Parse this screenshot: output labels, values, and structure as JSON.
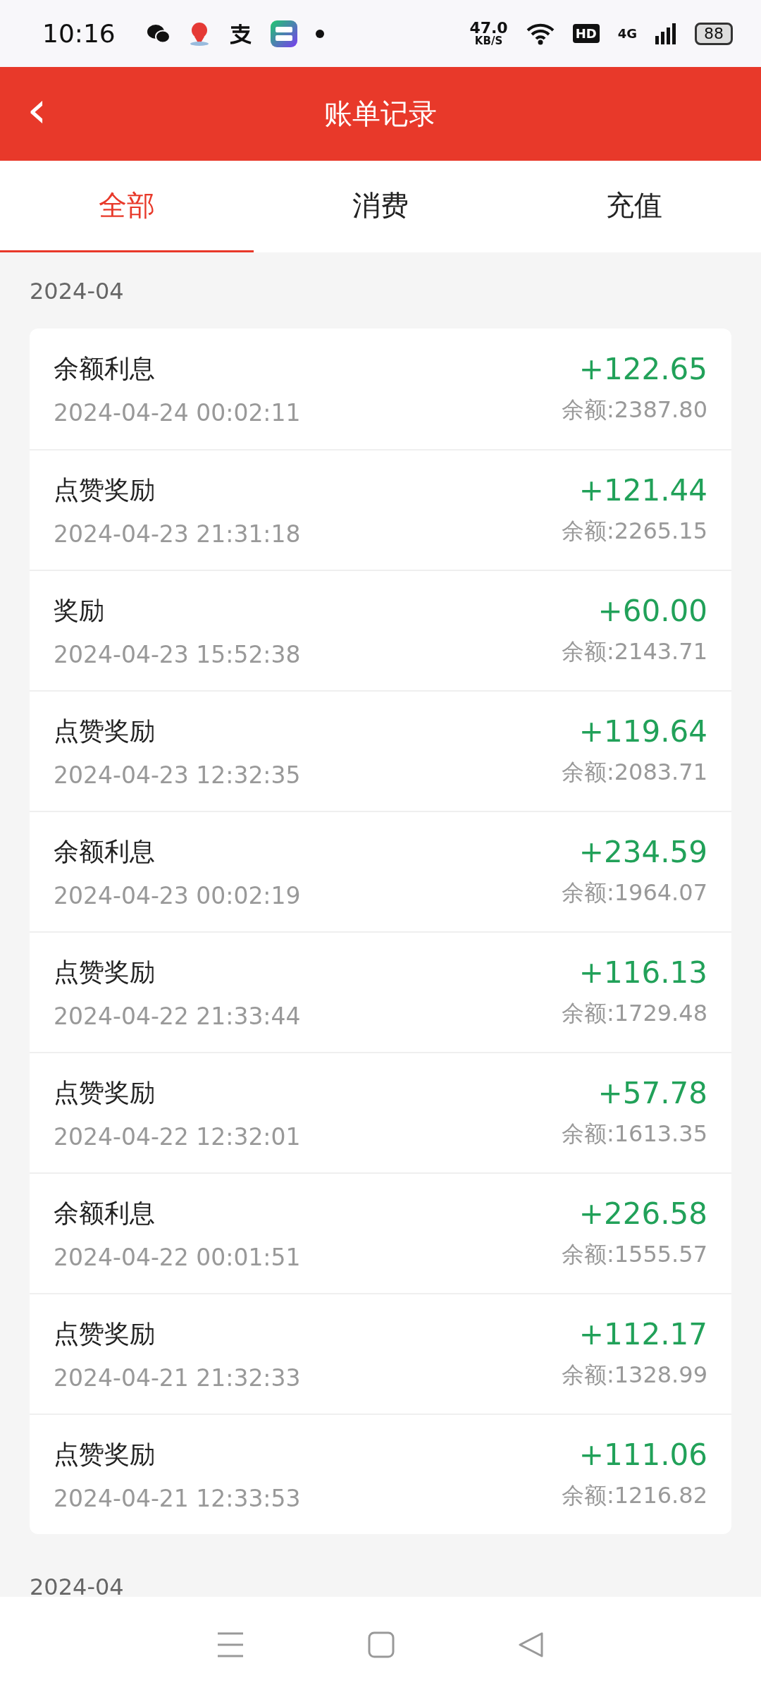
{
  "status_bar": {
    "time": "10:16",
    "net_speed": "47.0",
    "net_unit": "KB/S",
    "hd": "HD",
    "network": "4G",
    "battery": "88"
  },
  "header": {
    "back": "‹",
    "title": "账单记录"
  },
  "tabs": [
    {
      "label": "全部",
      "selected": true
    },
    {
      "label": "消费",
      "selected": false
    },
    {
      "label": "充值",
      "selected": false
    }
  ],
  "sections": [
    {
      "month": "2024-04",
      "records": [
        {
          "title": "余额利息",
          "time": "2024-04-24 00:02:11",
          "amount": "+122.65",
          "balance": "余额:2387.80"
        },
        {
          "title": "点赞奖励",
          "time": "2024-04-23 21:31:18",
          "amount": "+121.44",
          "balance": "余额:2265.15"
        },
        {
          "title": "奖励",
          "time": "2024-04-23 15:52:38",
          "amount": "+60.00",
          "balance": "余额:2143.71"
        },
        {
          "title": "点赞奖励",
          "time": "2024-04-23 12:32:35",
          "amount": "+119.64",
          "balance": "余额:2083.71"
        },
        {
          "title": "余额利息",
          "time": "2024-04-23 00:02:19",
          "amount": "+234.59",
          "balance": "余额:1964.07"
        },
        {
          "title": "点赞奖励",
          "time": "2024-04-22 21:33:44",
          "amount": "+116.13",
          "balance": "余额:1729.48"
        },
        {
          "title": "点赞奖励",
          "time": "2024-04-22 12:32:01",
          "amount": "+57.78",
          "balance": "余额:1613.35"
        },
        {
          "title": "余额利息",
          "time": "2024-04-22 00:01:51",
          "amount": "+226.58",
          "balance": "余额:1555.57"
        },
        {
          "title": "点赞奖励",
          "time": "2024-04-21 21:32:33",
          "amount": "+112.17",
          "balance": "余额:1328.99"
        },
        {
          "title": "点赞奖励",
          "time": "2024-04-21 12:33:53",
          "amount": "+111.06",
          "balance": "余额:1216.82"
        }
      ]
    },
    {
      "month": "2024-04"
    }
  ]
}
